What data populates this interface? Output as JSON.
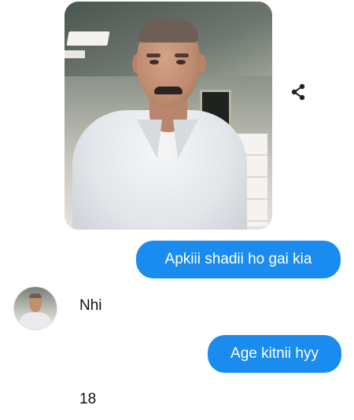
{
  "conversation": {
    "shared_image": {
      "alt": "Photo of a man in a white shirt"
    },
    "messages": [
      {
        "direction": "outgoing",
        "text": "Apkiii shadii ho gai kia"
      },
      {
        "direction": "incoming",
        "text": "Nhi"
      },
      {
        "direction": "outgoing",
        "text": "Age kitnii hyy"
      },
      {
        "direction": "incoming",
        "text": "18"
      }
    ]
  },
  "icons": {
    "share": "share-icon",
    "avatar": "contact-avatar"
  },
  "colors": {
    "outgoing_bubble": "#1a8cf0",
    "outgoing_text": "#ffffff",
    "incoming_text": "#111111",
    "background": "#ffffff"
  }
}
